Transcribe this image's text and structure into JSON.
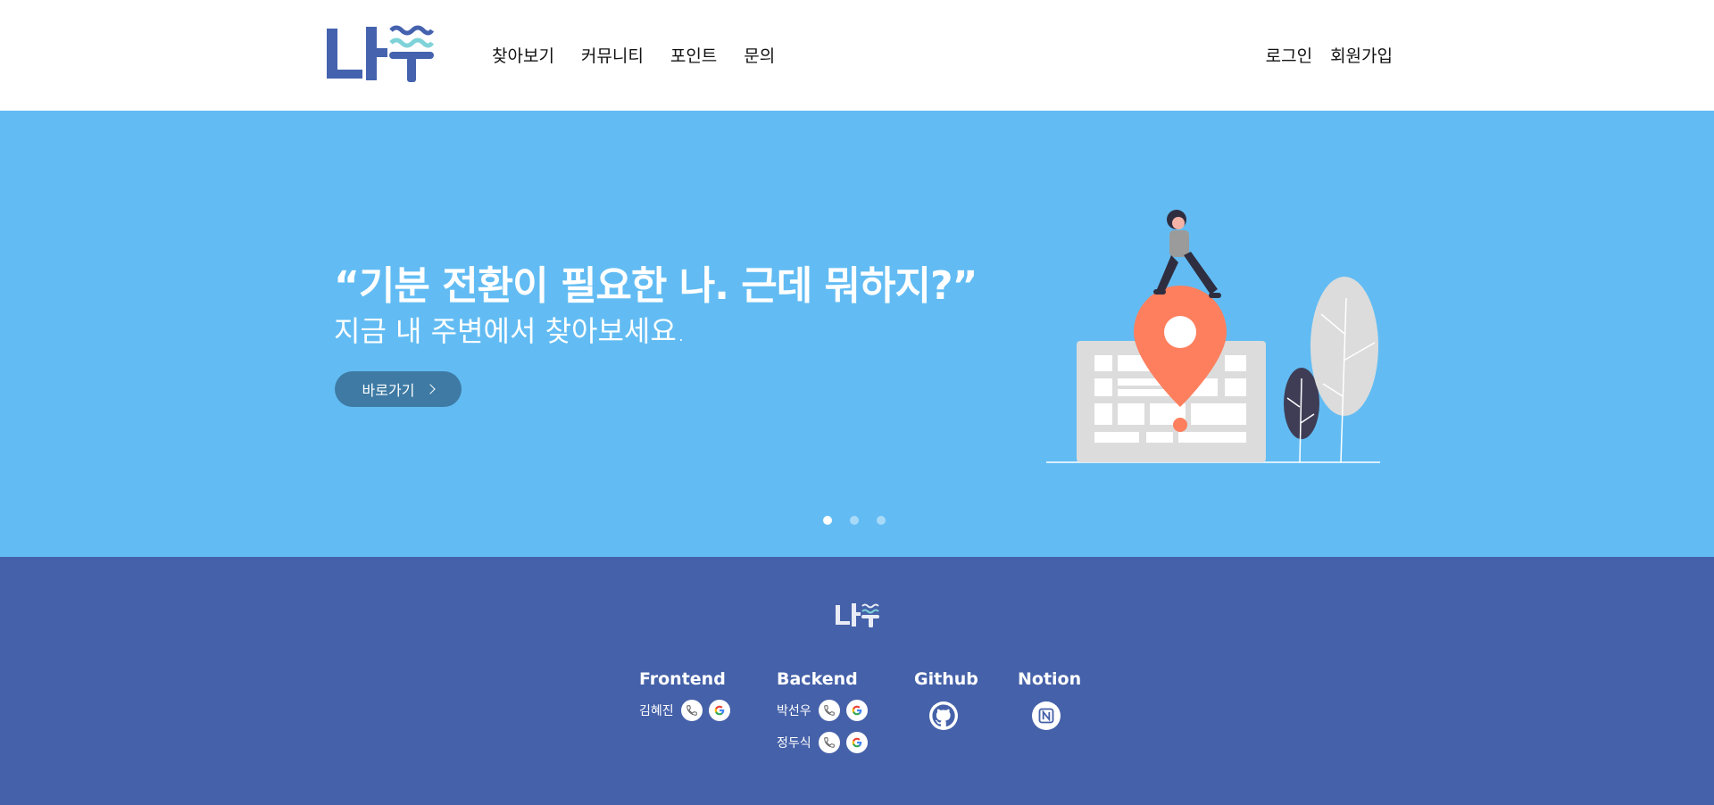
{
  "header": {
    "logo_text": "나푸",
    "nav": [
      "찾아보기",
      "커뮤니티",
      "포인트",
      "문의"
    ],
    "auth": [
      "로그인",
      "회원가입"
    ]
  },
  "hero": {
    "title": "“기분 전환이 필요한 나. 근데 뭐하지?”",
    "subtitle": "지금 내 주변에서 찾아보세요.",
    "button_label": "바로가기",
    "slides_count": 3,
    "active_slide": 1
  },
  "footer": {
    "logo_text": "나푸",
    "columns": {
      "frontend": {
        "title": "Frontend",
        "members": [
          "김혜진"
        ]
      },
      "backend": {
        "title": "Backend",
        "members": [
          "박선우",
          "정두식"
        ]
      },
      "github": {
        "title": "Github",
        "icon": "github-icon"
      },
      "notion": {
        "title": "Notion",
        "icon": "notion-icon"
      }
    }
  },
  "colors": {
    "hero_bg": "#62bcf3",
    "footer_bg": "#4561a9",
    "brand_blue": "#3f5fae",
    "accent_teal": "#7fd3d8",
    "button_bg": "#3e7aa4",
    "pin": "#fd7f5e"
  }
}
